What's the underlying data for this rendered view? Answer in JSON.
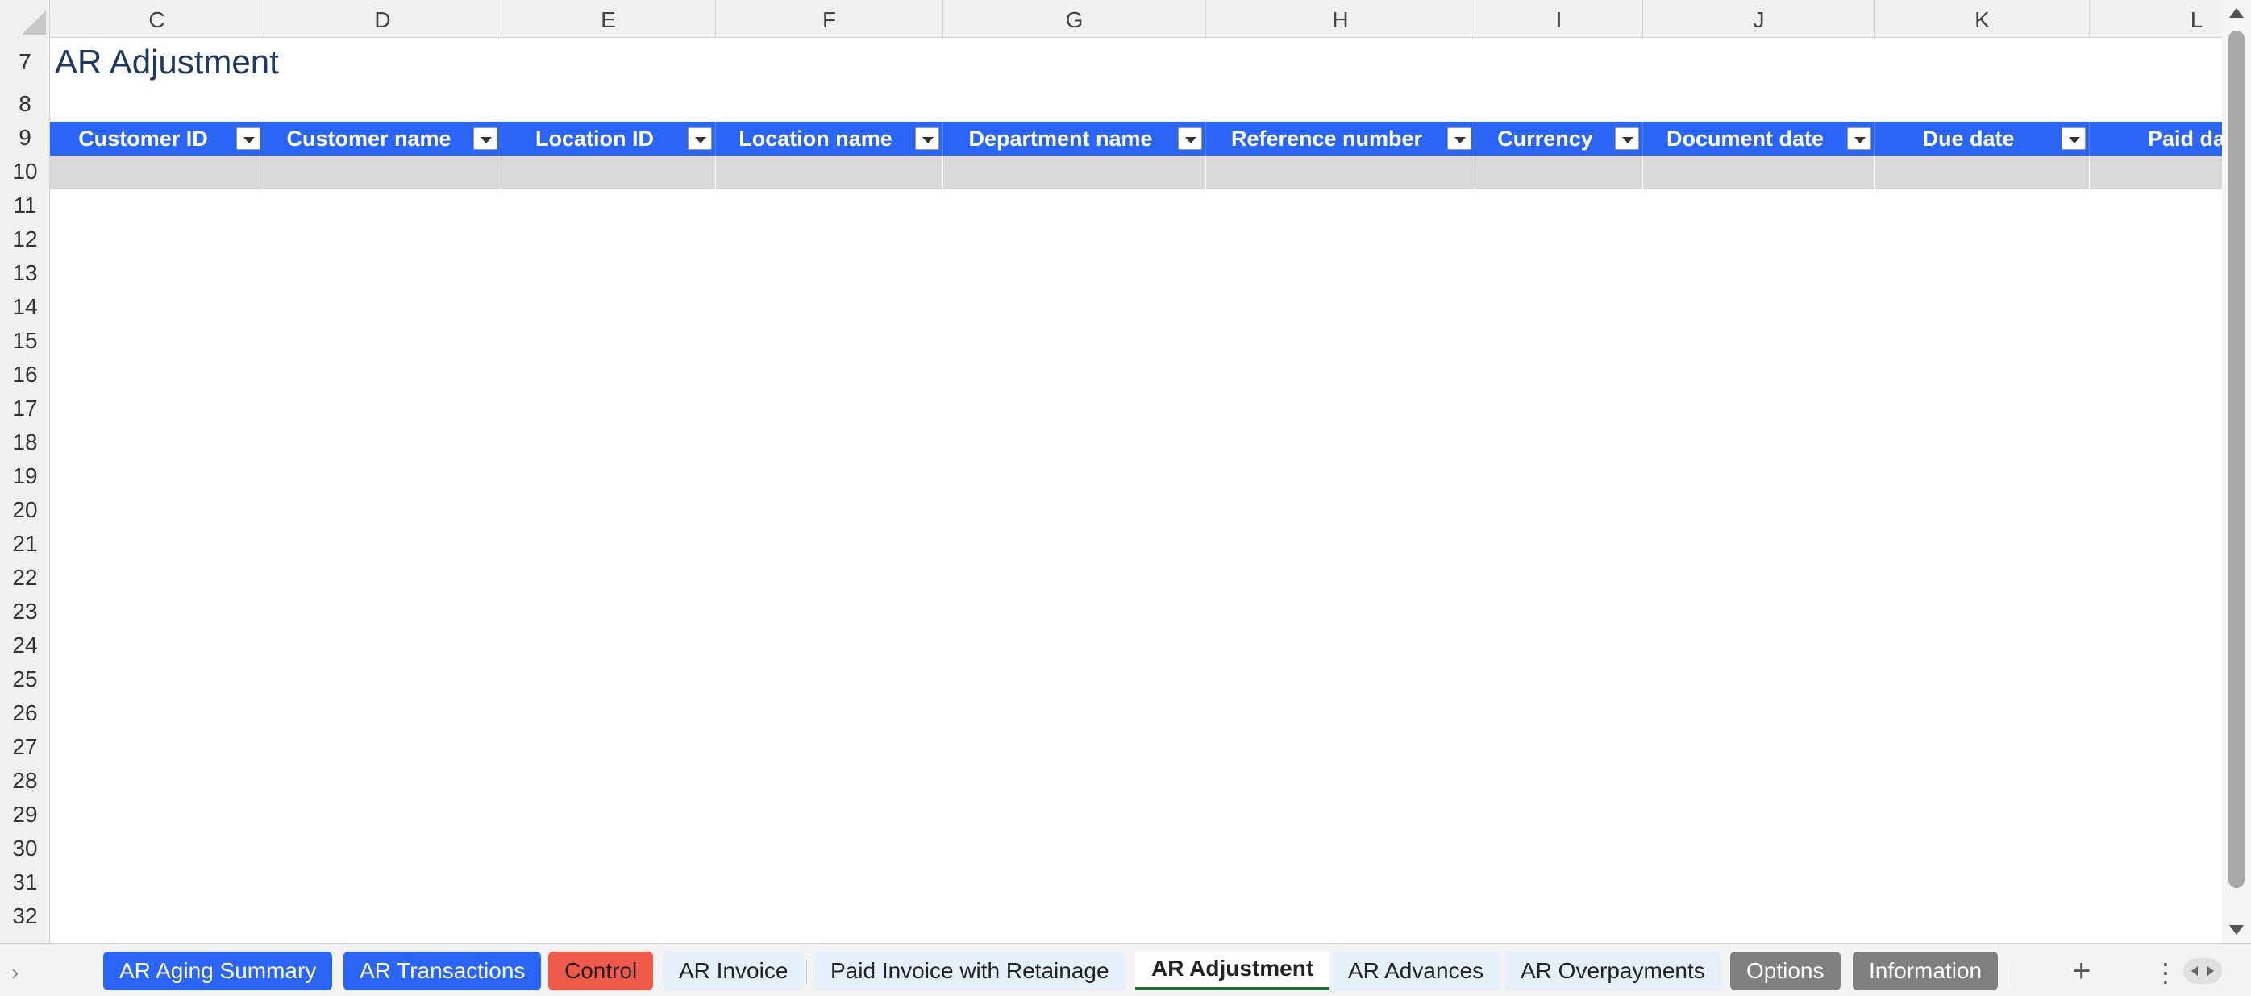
{
  "columns": [
    "C",
    "D",
    "E",
    "F",
    "G",
    "H",
    "I",
    "J",
    "K",
    "L"
  ],
  "rows": [
    "7",
    "8",
    "9",
    "10",
    "11",
    "12",
    "13",
    "14",
    "15",
    "16",
    "17",
    "18",
    "19",
    "20",
    "21",
    "22",
    "23",
    "24",
    "25",
    "26",
    "27",
    "28",
    "29",
    "30",
    "31",
    "32"
  ],
  "sheet": {
    "title": "AR Adjustment",
    "table_headers": [
      "Customer ID",
      "Customer name",
      "Location ID",
      "Location name",
      "Department name",
      "Reference number",
      "Currency",
      "Document date",
      "Due date",
      "Paid da"
    ]
  },
  "tabs": [
    {
      "label": "AR Aging Summary",
      "style": "blue"
    },
    {
      "label": "AR Transactions",
      "style": "blue"
    },
    {
      "label": "Control",
      "style": "red"
    },
    {
      "label": "AR Invoice",
      "style": "light"
    },
    {
      "label": "Paid Invoice with Retainage",
      "style": "light"
    },
    {
      "label": "AR Adjustment",
      "style": "active"
    },
    {
      "label": "AR Advances",
      "style": "light"
    },
    {
      "label": "AR Overpayments",
      "style": "light"
    },
    {
      "label": "Options",
      "style": "gray"
    },
    {
      "label": "Information",
      "style": "gray"
    }
  ],
  "icons": {
    "add_sheet": "plus-icon",
    "more": "vertical-ellipsis-icon",
    "tabs_nav": "chevron-right-icon"
  },
  "colors": {
    "header_blue": "#2a65f5",
    "title_navy": "#1f3864",
    "active_green": "#1e6b3a",
    "control_red": "#f05a4a",
    "tab_gray": "#7f7f7f"
  }
}
